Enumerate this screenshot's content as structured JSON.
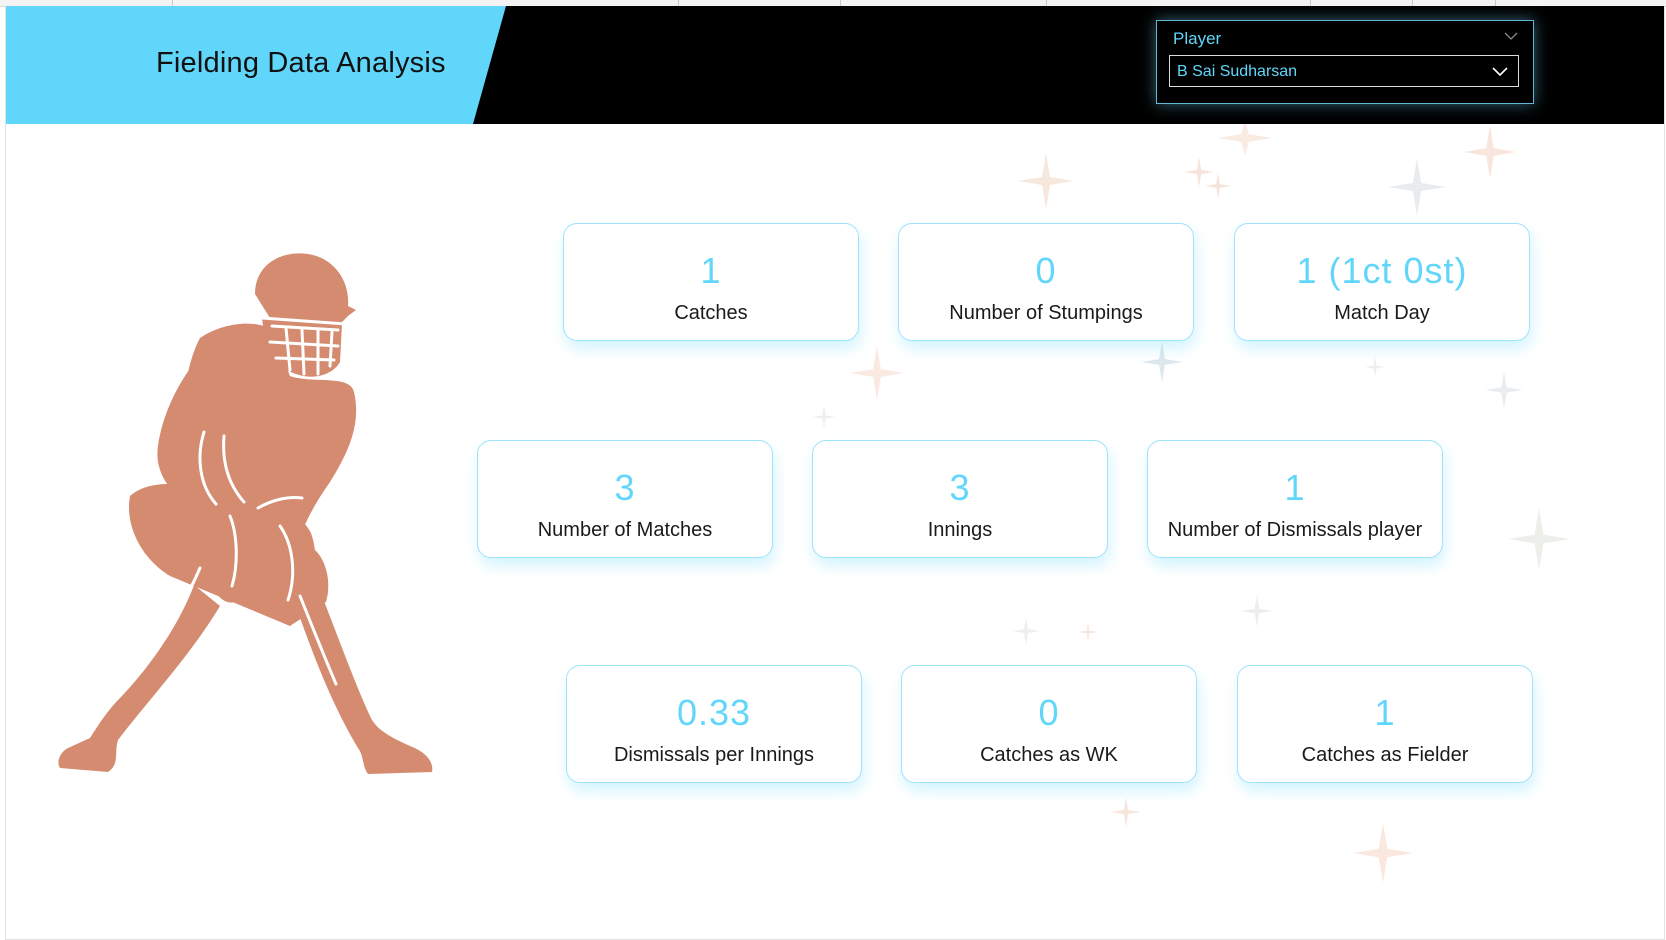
{
  "header": {
    "title": "Fielding Data Analysis"
  },
  "slicer": {
    "title": "Player",
    "selected": "B Sai Sudharsan"
  },
  "cards": [
    {
      "value": "1",
      "label": "Catches"
    },
    {
      "value": "0",
      "label": "Number of Stumpings"
    },
    {
      "value": "1 (1ct 0st)",
      "label": "Match Day"
    },
    {
      "value": "3",
      "label": "Number of Matches"
    },
    {
      "value": "3",
      "label": "Innings"
    },
    {
      "value": "1",
      "label": "Number of Dismissals player"
    },
    {
      "value": "0.33",
      "label": "Dismissals per Innings"
    },
    {
      "value": "0",
      "label": "Catches as WK"
    },
    {
      "value": "1",
      "label": "Catches as Fielder"
    }
  ],
  "colors": {
    "accent": "#61d6fb",
    "header_bg": "#000000",
    "figure": "#d48b70"
  }
}
